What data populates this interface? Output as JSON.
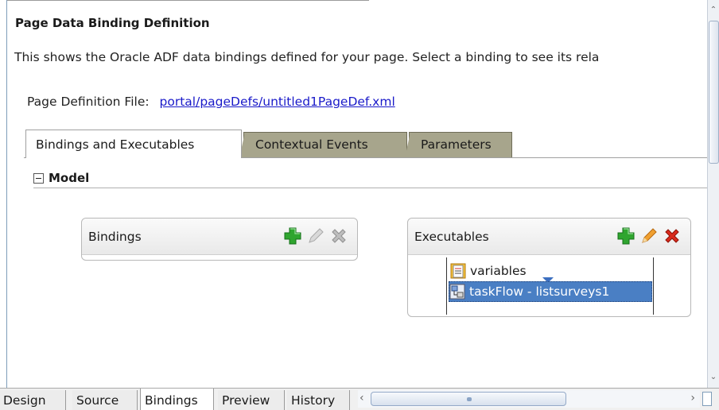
{
  "header": {
    "title": "Page Data Binding Definition",
    "description": "This shows the Oracle ADF data bindings defined for your page. Select a binding to see its rela"
  },
  "page_definition": {
    "label": "Page Definition File:",
    "link": "portal/pageDefs/untitled1PageDef.xml"
  },
  "tabs": [
    {
      "label": "Bindings and Executables",
      "selected": true
    },
    {
      "label": "Contextual Events",
      "selected": false
    },
    {
      "label": "Parameters",
      "selected": false
    }
  ],
  "model": {
    "label": "Model"
  },
  "bindings_panel": {
    "title": "Bindings",
    "tools": [
      "add-icon",
      "edit-icon",
      "delete-icon"
    ],
    "items": []
  },
  "executables_panel": {
    "title": "Executables",
    "tools": [
      "add-icon",
      "edit-icon",
      "delete-icon"
    ],
    "items": [
      {
        "label": "variables",
        "icon": "variables-icon",
        "selected": false
      },
      {
        "label": "taskFlow - listsurveys1",
        "icon": "taskflow-icon",
        "selected": true
      }
    ]
  },
  "editor_tabs": [
    {
      "label": "Design",
      "selected": false
    },
    {
      "label": "Source",
      "selected": false
    },
    {
      "label": "Bindings",
      "selected": true
    },
    {
      "label": "Preview",
      "selected": false
    },
    {
      "label": "History",
      "selected": false
    }
  ],
  "colors": {
    "accent_tab": "#a7a58c",
    "selection": "#4a7fc4",
    "link": "#1a1ac9",
    "add_green": "#2fa52f",
    "delete_red": "#d92a1c"
  }
}
